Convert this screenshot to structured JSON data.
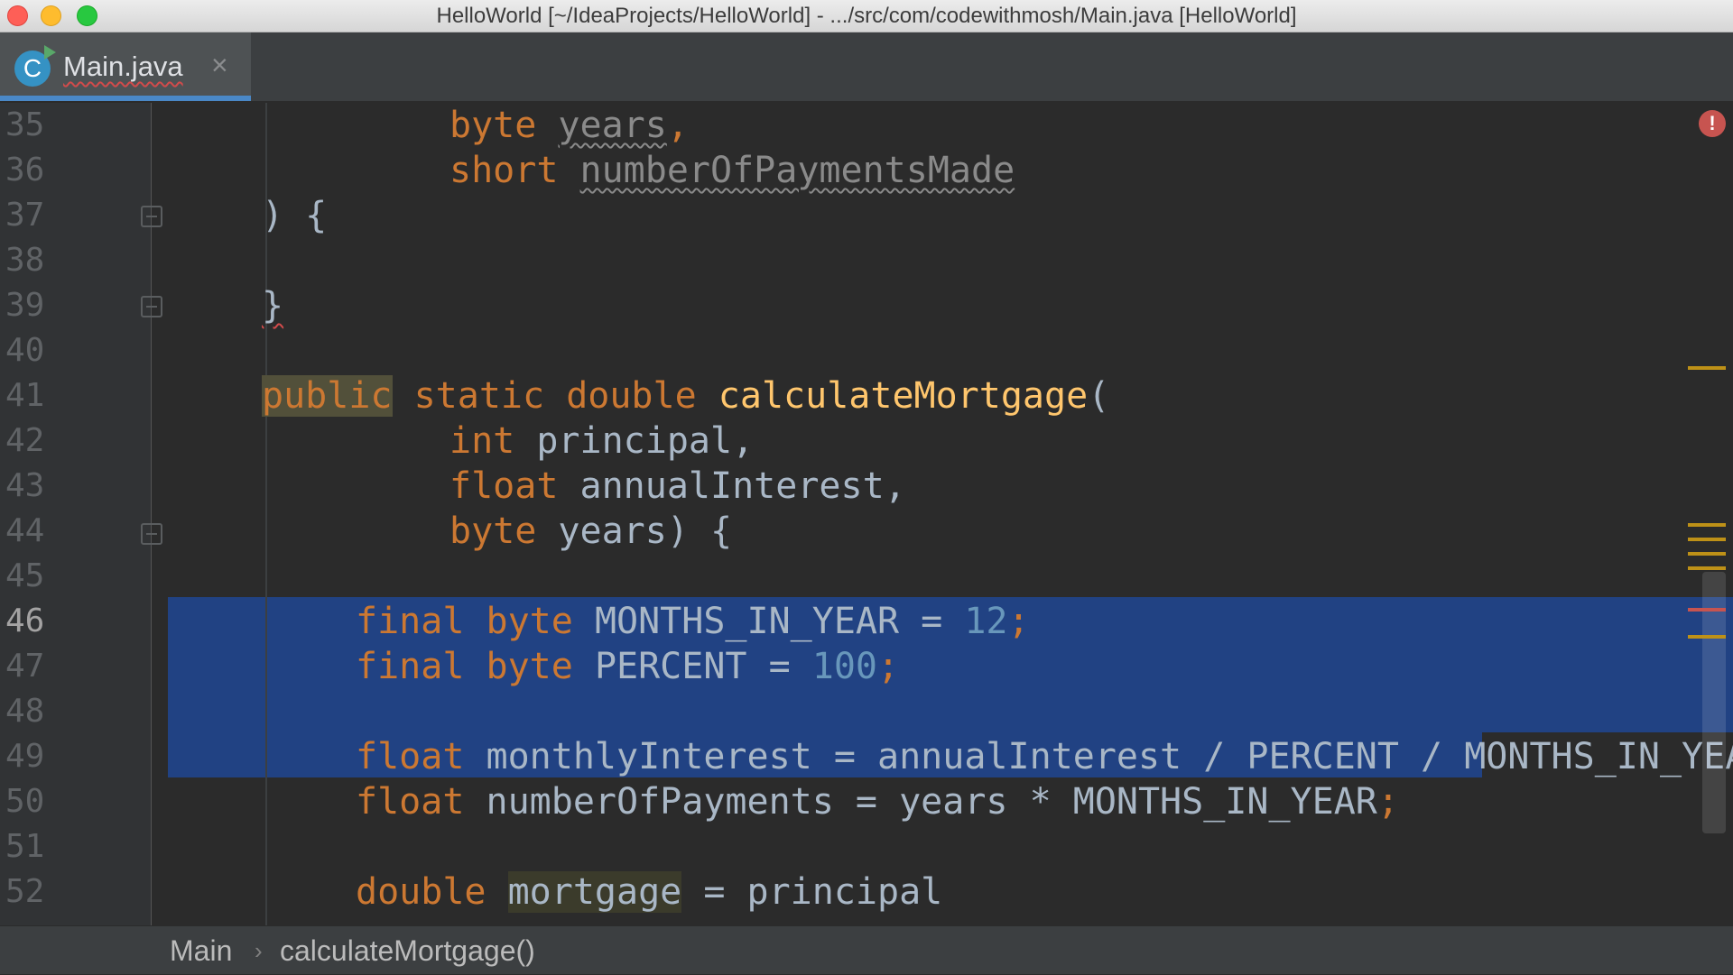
{
  "window": {
    "title": "HelloWorld [~/IdeaProjects/HelloWorld] - .../src/com/codewithmosh/Main.java [HelloWorld]"
  },
  "tab": {
    "label": "Main.java",
    "icon": "java-class-icon",
    "close": "×"
  },
  "editor": {
    "current_line": "46",
    "lines": [
      {
        "n": "35",
        "t": "byte years,"
      },
      {
        "n": "36",
        "t": "short numberOfPaymentsMade"
      },
      {
        "n": "37",
        "t": ") {"
      },
      {
        "n": "38",
        "t": ""
      },
      {
        "n": "39",
        "t": "}"
      },
      {
        "n": "40",
        "t": ""
      },
      {
        "n": "41",
        "t": "public static double calculateMortgage("
      },
      {
        "n": "42",
        "t": "int principal,"
      },
      {
        "n": "43",
        "t": "float annualInterest,"
      },
      {
        "n": "44",
        "t": "byte years) {"
      },
      {
        "n": "45",
        "t": ""
      },
      {
        "n": "46",
        "t": "final byte MONTHS_IN_YEAR = 12;"
      },
      {
        "n": "47",
        "t": "final byte PERCENT = 100;"
      },
      {
        "n": "48",
        "t": ""
      },
      {
        "n": "49",
        "t": "float monthlyInterest = annualInterest / PERCENT / MONTHS_IN_YEAR;"
      },
      {
        "n": "50",
        "t": "float numberOfPayments = years * MONTHS_IN_YEAR;"
      },
      {
        "n": "51",
        "t": ""
      },
      {
        "n": "52",
        "t": "double mortgage = principal"
      }
    ],
    "tokens": {
      "l35a": "byte",
      "l35b": "years",
      "l35c": ",",
      "l36a": "short",
      "l36b": "numberOfPaymentsMade",
      "l37": ") {",
      "l39": "}",
      "l41a": "public",
      "l41b": "static",
      "l41c": "double",
      "l41d": "calculateMortgage",
      "l41e": "(",
      "l42a": "int",
      "l42b": "principal,",
      "l43a": "float",
      "l43b": "annualInterest,",
      "l44a": "byte",
      "l44b": "years) {",
      "l46a": "final",
      "l46b": "byte",
      "l46c": "MONTHS_IN_YEAR = ",
      "l46d": "12",
      "l46e": ";",
      "l47a": "final",
      "l47b": "byte",
      "l47c": "PERCENT = ",
      "l47d": "100",
      "l47e": ";",
      "l49a": "float",
      "l49b": "monthlyInterest = annualInterest / PERCENT / MONTHS_IN_YEAR;",
      "l50a": "float",
      "l50b": "numberOfPayments = years * MONTHS_IN_YEAR",
      "l50c": ";",
      "l52a": "double",
      "l52b": "mortgage",
      "l52c": " = principal"
    }
  },
  "breadcrumb": {
    "class": "Main",
    "method": "calculateMortgage()",
    "separator": "›"
  },
  "colors": {
    "background": "#2b2b2b",
    "keyword": "#cc7832",
    "function": "#ffc66d",
    "number": "#6897bb",
    "text": "#a9b7c6",
    "selection": "#214283",
    "error": "#c75450"
  }
}
